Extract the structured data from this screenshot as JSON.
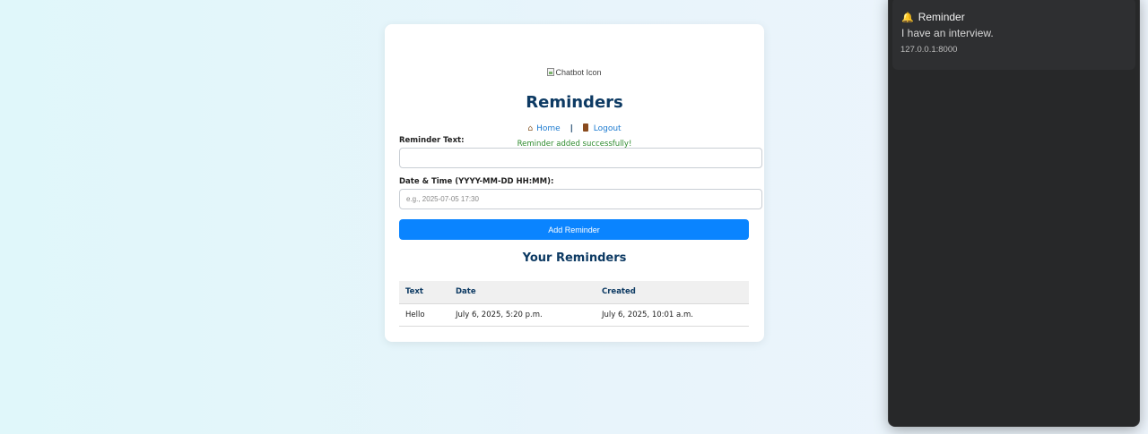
{
  "page": {
    "logo_alt": "Chatbot Icon",
    "title": "Reminders",
    "nav": {
      "home_icon": "house-icon",
      "home_label": "Home",
      "separator": "|",
      "logout_icon": "door-icon",
      "logout_label": "Logout"
    },
    "flash_message": "Reminder added successfully!",
    "form": {
      "text_label": "Reminder Text:",
      "text_value": "",
      "datetime_label": "Date & Time (YYYY-MM-DD HH:MM):",
      "datetime_placeholder": "e.g., 2025-07-05 17:30",
      "submit_label": "Add Reminder"
    },
    "list_title": "Your Reminders",
    "table": {
      "headers": [
        "Text",
        "Date",
        "Created"
      ],
      "rows": [
        [
          "Hello",
          "July 6, 2025, 5:20 p.m.",
          "July 6, 2025, 10:01 a.m."
        ]
      ]
    }
  },
  "notification": {
    "icon": "bell-icon",
    "title": "Reminder",
    "body": "I have an interview.",
    "source": "127.0.0.1:8000"
  },
  "colors": {
    "accent": "#0a84ff",
    "heading": "#0d3a63",
    "success": "#2e8b2e",
    "panel_bg": "#272829"
  }
}
